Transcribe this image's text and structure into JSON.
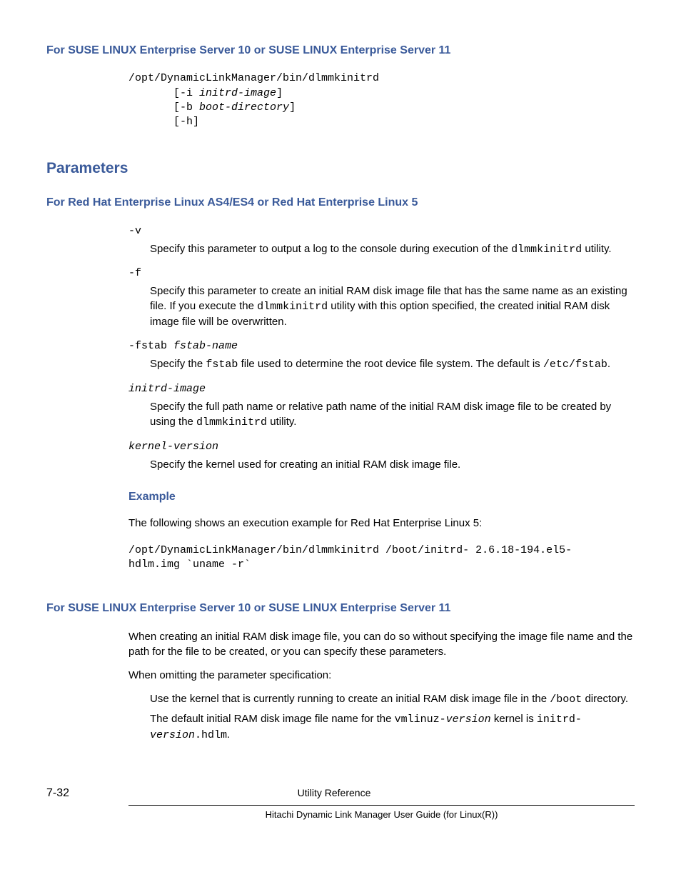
{
  "headings": {
    "suse1": "For SUSE LINUX Enterprise Server 10 or SUSE LINUX Enterprise Server 11",
    "params": "Parameters",
    "redhat": "For Red Hat Enterprise Linux AS4/ES4 or Red Hat Enterprise Linux 5",
    "example": "Example",
    "suse2": "For SUSE LINUX Enterprise Server 10 or SUSE LINUX Enterprise Server 11"
  },
  "code_block1": {
    "line1": "/opt/DynamicLinkManager/bin/dlmmkinitrd",
    "line2_pre": "       [-i ",
    "line2_ital": "initrd-image",
    "line2_post": "]",
    "line3_pre": "       [-b ",
    "line3_ital": "boot-directory",
    "line3_post": "]",
    "line4": "       [-h]"
  },
  "opts": {
    "v": {
      "term": "-v",
      "desc_a": "Specify this parameter to output a log to the console during execution of the ",
      "desc_code": "dlmmkinitrd",
      "desc_b": " utility."
    },
    "f": {
      "term": "-f",
      "desc_a": "Specify this parameter to create an initial RAM disk image file that has the same name as an existing file. If you execute the ",
      "desc_code": "dlmmkinitrd",
      "desc_b": " utility with this option specified, the created initial RAM disk image file will be overwritten."
    },
    "fstab": {
      "term_pre": "-fstab ",
      "term_ital": "fstab-name",
      "desc_a": "Specify the ",
      "desc_code1": "fstab",
      "desc_b": " file used to determine the root device file system. The default is ",
      "desc_code2": "/etc/fstab",
      "desc_c": "."
    },
    "initrd": {
      "term_ital": "initrd-image",
      "desc_a": "Specify the full path name or relative path name of the initial RAM disk image file to be created by using the ",
      "desc_code": "dlmmkinitrd",
      "desc_b": " utility."
    },
    "kernel": {
      "term_ital": "kernel-version",
      "desc": "Specify the kernel used for creating an initial RAM disk image file."
    }
  },
  "example_text": "The following shows an execution example for Red Hat Enterprise Linux 5:",
  "example_code": {
    "line1": "/opt/DynamicLinkManager/bin/dlmmkinitrd /boot/initrd- 2.6.18-194.el5-",
    "line2": "hdlm.img `uname -r`"
  },
  "suse2_body": {
    "p1": "When creating an initial RAM disk image file, you can do so without specifying the image file name and the path for the file to be created, or you can specify these parameters.",
    "p2": "When omitting the parameter specification:",
    "p3_a": "Use the kernel that is currently running to create an initial RAM disk image file in the ",
    "p3_code": "/boot",
    "p3_b": " directory.",
    "p4_a": "The default initial RAM disk image file name for the ",
    "p4_code1_pre": "vmlinuz-",
    "p4_code1_ital": "version",
    "p4_b": " kernel is ",
    "p4_code2_pre": "initrd-",
    "p4_code2_ital": "version",
    "p4_code2_post": ".hdlm",
    "p4_c": "."
  },
  "footer": {
    "page": "7-32",
    "title": "Utility Reference",
    "sub": "Hitachi Dynamic Link Manager User Guide (for Linux(R))"
  }
}
